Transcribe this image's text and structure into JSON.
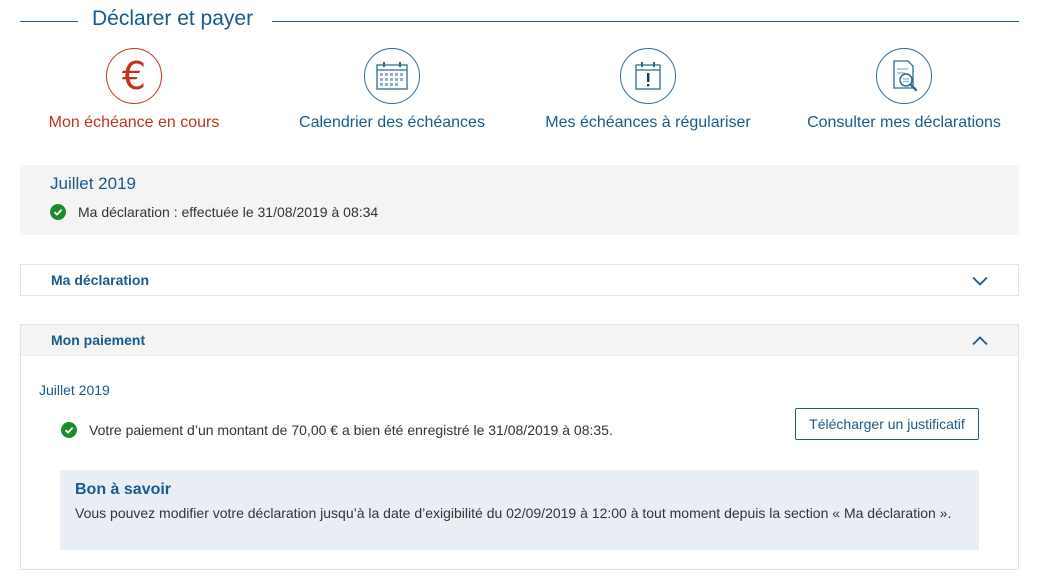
{
  "section": {
    "title": "Déclarer et payer"
  },
  "tiles": [
    {
      "label": "Mon échéance en cours",
      "icon": "euro-icon",
      "symbol": "€",
      "active": true
    },
    {
      "label": "Calendrier des échéances",
      "icon": "calendar-icon"
    },
    {
      "label": "Mes échéances à régulariser",
      "icon": "calendar-alert-icon"
    },
    {
      "label": "Consulter mes déclarations",
      "icon": "document-search-icon"
    }
  ],
  "summary": {
    "period": "Juillet 2019",
    "status": "Ma déclaration : effectuée le 31/08/2019 à 08:34"
  },
  "declaration": {
    "title": "Ma déclaration",
    "expanded": false
  },
  "payment": {
    "title": "Mon paiement",
    "expanded": true,
    "period": "Juillet 2019",
    "status": "Votre paiement d’un montant de 70,00 € a bien été enregistré le 31/08/2019 à 08:35.",
    "download_label": "Télécharger un justificatif",
    "info_title": "Bon à savoir",
    "info_text": "Vous pouvez modifier votre déclaration jusqu’à la date d’exigibilité du 02/09/2019 à 12:00 à tout moment depuis la section « Ma déclaration »."
  },
  "colors": {
    "primary": "#1a5a8a",
    "active": "#c0341d",
    "success": "#1e8a2e",
    "panel": "#f4f4f4",
    "info": "#e8eef4"
  }
}
